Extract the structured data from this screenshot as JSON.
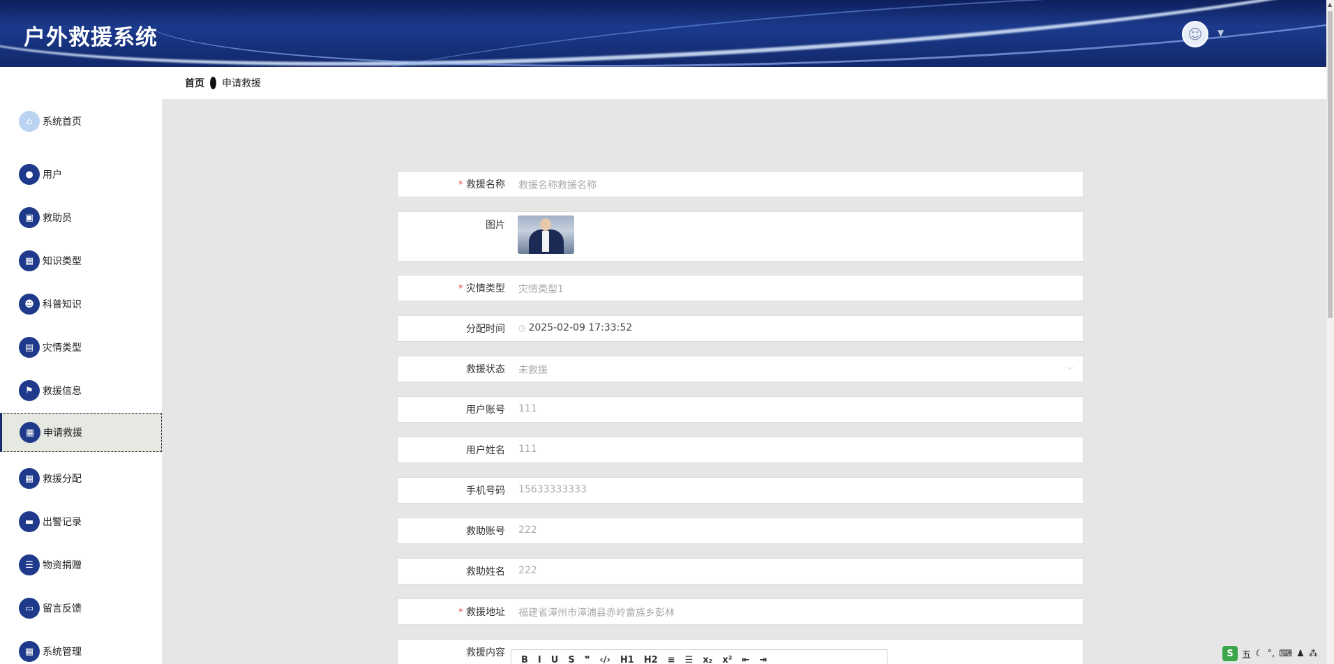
{
  "app": {
    "title": "户外救援系统"
  },
  "header": {
    "avatar_icon": "user-avatar-icon",
    "caret": "▼"
  },
  "breadcrumb": {
    "home": "首页",
    "current": "申请救援"
  },
  "sidebar": {
    "items": [
      {
        "label": "系统首页",
        "icon": "home-icon",
        "glyph": "⌂"
      },
      {
        "label": "用户",
        "icon": "user-icon",
        "glyph": "●"
      },
      {
        "label": "救助员",
        "icon": "clipboard-icon",
        "glyph": "▣"
      },
      {
        "label": "知识类型",
        "icon": "grid-icon",
        "glyph": "▦"
      },
      {
        "label": "科普知识",
        "icon": "person-icon",
        "glyph": "☻"
      },
      {
        "label": "灾情类型",
        "icon": "chart-icon",
        "glyph": "▤"
      },
      {
        "label": "救援信息",
        "icon": "flag-icon",
        "glyph": "⚑"
      },
      {
        "label": "申请救援",
        "icon": "grid-icon",
        "glyph": "▦"
      },
      {
        "label": "救援分配",
        "icon": "grid-icon",
        "glyph": "▦"
      },
      {
        "label": "出警记录",
        "icon": "monitor-icon",
        "glyph": "▬"
      },
      {
        "label": "物资捐赠",
        "icon": "list-icon",
        "glyph": "☰"
      },
      {
        "label": "留言反馈",
        "icon": "inbox-icon",
        "glyph": "▭"
      },
      {
        "label": "系统管理",
        "icon": "grid-icon",
        "glyph": "▦"
      }
    ]
  },
  "form": {
    "rescue_name": {
      "label": "救援名称",
      "placeholder": "救援名称救援名称"
    },
    "image": {
      "label": "图片"
    },
    "disaster_type": {
      "label": "灾情类型",
      "value": "灾情类型1"
    },
    "assign_time": {
      "label": "分配时间",
      "value": "2025-02-09 17:33:52"
    },
    "rescue_status": {
      "label": "救援状态",
      "value": "未救援"
    },
    "user_account": {
      "label": "用户账号",
      "value": "111"
    },
    "user_name": {
      "label": "用户姓名",
      "value": "111"
    },
    "phone": {
      "label": "手机号码",
      "value": "15633333333"
    },
    "helper_account": {
      "label": "救助账号",
      "value": "222"
    },
    "helper_name": {
      "label": "救助姓名",
      "value": "222"
    },
    "rescue_address": {
      "label": "救援地址",
      "value": "福建省漳州市漳浦县赤岭畲族乡彭林"
    },
    "rescue_content": {
      "label": "救援内容"
    }
  },
  "editor": {
    "buttons": [
      "B",
      "I",
      "U",
      "S",
      "❞",
      "‹/›",
      "H1",
      "H2",
      "≡",
      "☰",
      "x₂",
      "x²",
      "⇤",
      "⇥"
    ]
  },
  "tray": {
    "ime": "五",
    "items": [
      "☾",
      "°,",
      "⌨",
      "♟",
      "⁂"
    ]
  }
}
